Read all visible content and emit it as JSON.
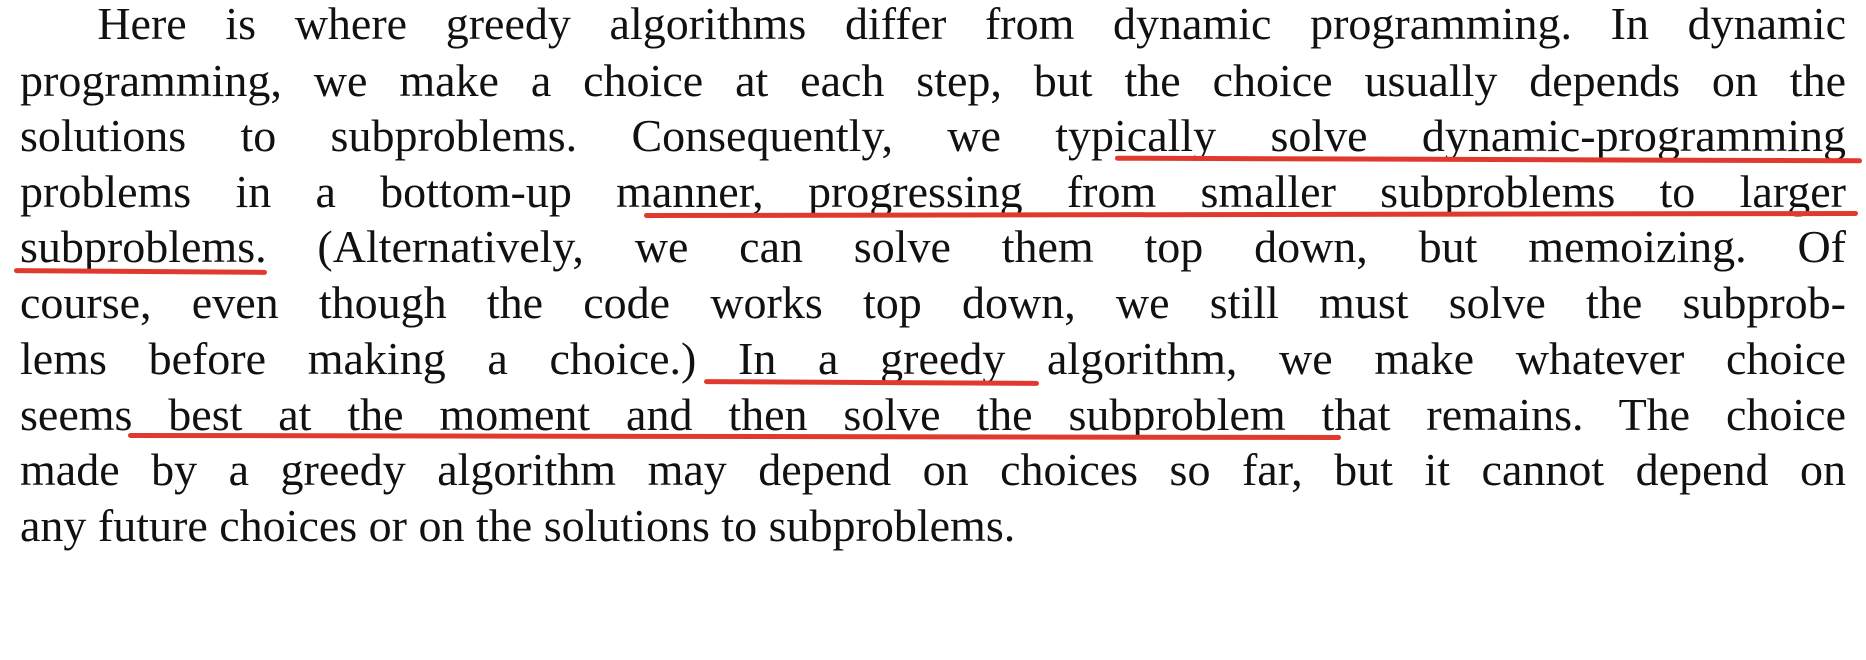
{
  "paragraph": {
    "lines": [
      "  Here is where greedy algorithms differ from dynamic programming. In dynamic",
      "programming, we make a choice at each step, but the choice usually depends on the",
      "solutions to subproblems. Consequently, we typically solve dynamic-programming",
      "problems in a bottom-up manner, progressing from smaller subproblems to larger",
      "subproblems. (Alternatively, we can solve them top down, but memoizing. Of",
      "course, even though the code works top down, we still must solve the subprob-",
      "lems before making a choice.) In a greedy algorithm, we make whatever choice",
      "seems best at the moment and then solve the subproblem that remains. The choice",
      "made by a greedy algorithm may depend on choices so far, but it cannot depend on",
      "any future choices or on the solutions to subproblems."
    ],
    "underline_color": "#e03a2f"
  }
}
